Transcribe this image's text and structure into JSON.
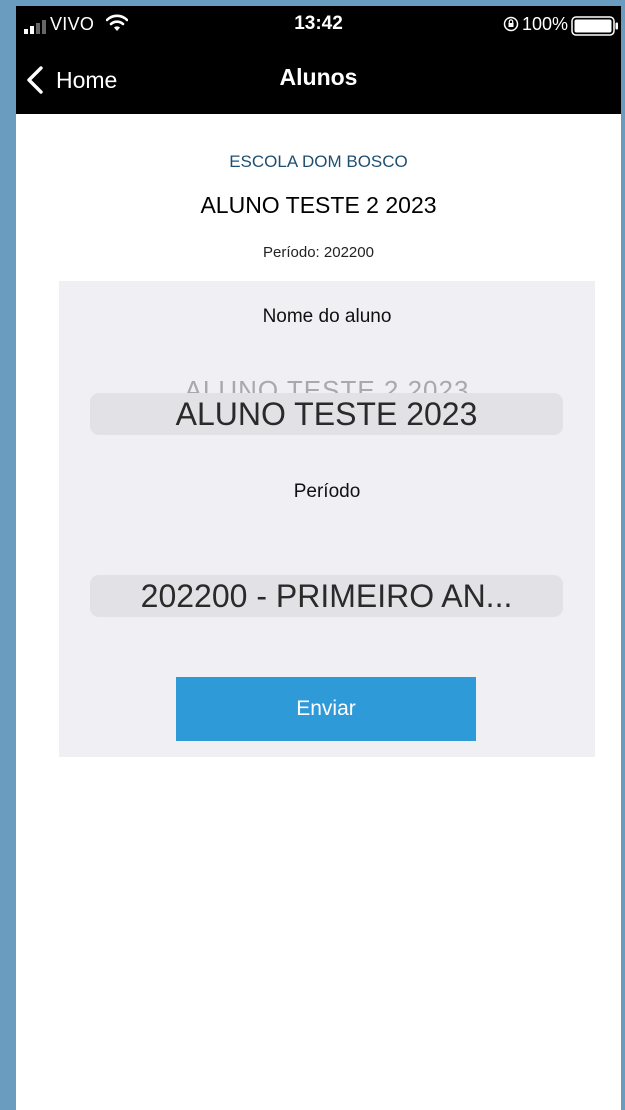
{
  "status_bar": {
    "carrier": "VIVO",
    "time": "13:42",
    "battery": "100%"
  },
  "nav": {
    "back_label": "Home",
    "title": "Alunos"
  },
  "header": {
    "school": "ESCOLA DOM BOSCO",
    "student": "ALUNO TESTE 2 2023",
    "period_label": "Período:",
    "period_value": "202200"
  },
  "form": {
    "student_field_label": "Nome do aluno",
    "student_picker": {
      "above_option": "ALUNO TESTE 2 2023",
      "selected": "ALUNO TESTE 2023"
    },
    "period_field_label": "Período",
    "period_picker": {
      "selected": "202200 - PRIMEIRO AN..."
    },
    "submit_label": "Enviar"
  },
  "colors": {
    "background_frame": "#6a9cc0",
    "header_bg": "#000000",
    "school_text": "#1f4f70",
    "card_bg": "#efeff4",
    "picker_bg": "#e2e2e6",
    "button_bg": "#2f9ad8"
  },
  "icons": [
    "signal-icon",
    "wifi-icon",
    "orientation-lock-icon",
    "battery-icon",
    "chevron-left-icon"
  ]
}
